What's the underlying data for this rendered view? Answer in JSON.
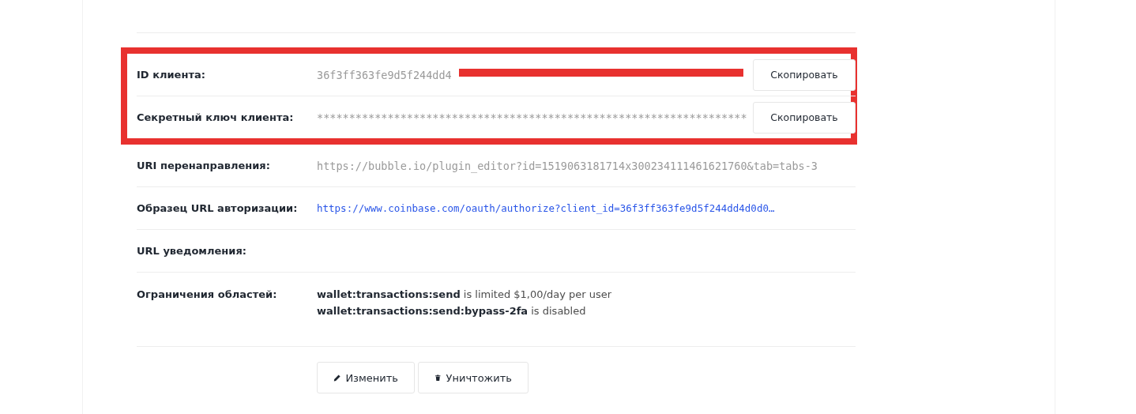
{
  "credentials": [
    {
      "label": "ID клиента:",
      "value": "36f3ff363fe9d5f244dd4",
      "redacted": true,
      "copy_button": "Скопировать"
    },
    {
      "label": "Секретный ключ клиента:",
      "value": "*******************************************************************",
      "redacted": false,
      "copy_button": "Скопировать"
    }
  ],
  "fields": [
    {
      "label": "URI перенаправления:",
      "value": "https://bubble.io/plugin_editor?id=1519063181714x300234111461621760&tab=tabs-3",
      "kind": "plain"
    },
    {
      "label": "Образец URL авторизации:",
      "value": "https://www.coinbase.com/oauth/authorize?client_id=36f3ff363fe9d5f244dd4d0d0…",
      "kind": "link"
    },
    {
      "label": "URL уведомления:",
      "kind": "empty"
    }
  ],
  "scopes": {
    "label": "Ограничения областей:",
    "lines": [
      "**wallet:transactions:send** is limited $1,00/day per user",
      "**wallet:transactions:send:bypass-2fa** is disabled"
    ]
  },
  "actions": [
    {
      "label": "Изменить",
      "kind": "edit"
    },
    {
      "label": "Уничтожить",
      "kind": "delete"
    }
  ]
}
